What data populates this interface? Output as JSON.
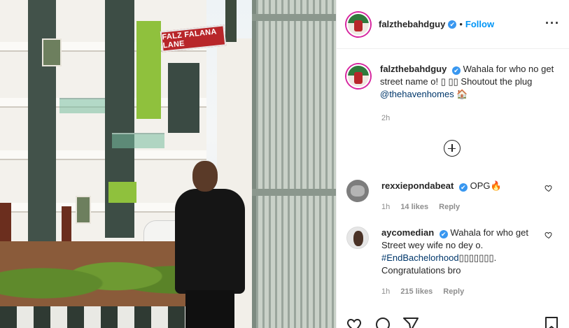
{
  "photo": {
    "street_sign": "FALZ FALANA LANE"
  },
  "header": {
    "username": "falzthebahdguy",
    "verified_glyph": "✔",
    "separator": "•",
    "follow_label": "Follow",
    "more_icon": "more-horizontal-icon"
  },
  "caption": {
    "username": "falzthebahdguy",
    "text_before": "Wahala for who no get street name o! ",
    "emoji": "▯ ▯▯",
    "text_middle": " Shoutout the plug ",
    "mention": "@thehavenhomes",
    "emoji_end": "🏠",
    "time": "2h"
  },
  "comments": [
    {
      "username": "rexxiepondabeat",
      "text": "OPG🔥",
      "time": "1h",
      "likes": "14 likes",
      "reply": "Reply"
    },
    {
      "username": "aycomedian",
      "text": "Wahala for who get Street wey wife no dey o. ",
      "hashtag": "#EndBachelorhood",
      "emoji": "▯▯▯▯▯▯▯",
      "tail": ". Congratulations bro",
      "time": "1h",
      "likes": "215 likes",
      "reply": "Reply"
    }
  ],
  "colors": {
    "link": "#0095f6",
    "mention": "#00376b",
    "muted": "#8e8e8e",
    "verified": "#3897f0"
  }
}
